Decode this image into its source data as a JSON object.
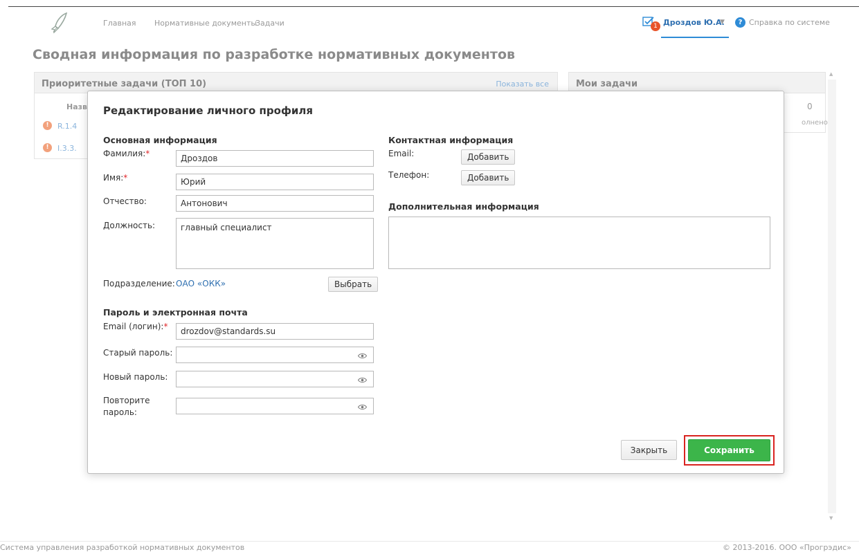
{
  "header": {
    "nav": [
      "Главная",
      "Нормативные документы",
      "Задачи"
    ],
    "notifications_count": "1",
    "user_name": "Дроздов Ю.А.",
    "help_label": "Справка по системе",
    "icons": [
      "rocket-logo-icon",
      "tasks-icon",
      "help-icon",
      "caret-down-icon"
    ]
  },
  "page": {
    "title": "Сводная информация по разработке нормативных документов"
  },
  "priority_panel": {
    "title": "Приоритетные задачи (ТОП 10)",
    "show_all": "Показать все",
    "column": "Назв",
    "rows": [
      "R.1.4",
      "I.3.3."
    ]
  },
  "my_tasks_panel": {
    "title": "Мои задачи",
    "count": "0",
    "status": "олнено"
  },
  "modal": {
    "title": "Редактирование личного профиля",
    "basic": {
      "section": "Основная информация",
      "last_name_label": "Фамилия:",
      "last_name": "Дроздов",
      "first_name_label": "Имя:",
      "first_name": "Юрий",
      "middle_name_label": "Отчество:",
      "middle_name": "Антонович",
      "position_label": "Должность:",
      "position": "главный специалист",
      "department_label": "Подразделение:",
      "department": "ОАО «ОКК»",
      "select_button": "Выбрать"
    },
    "password": {
      "section": "Пароль и электронная почта",
      "email_label": "Email (логин):",
      "email": "drozdov@standards.su",
      "old_password_label": "Старый пароль:",
      "new_password_label": "Новый пароль:",
      "repeat_password_label_1": "Повторите",
      "repeat_password_label_2": "пароль:"
    },
    "contact": {
      "section": "Контактная информация",
      "email_label": "Email:",
      "phone_label": "Телефон:",
      "add_button": "Добавить"
    },
    "additional": {
      "section": "Дополнительная информация",
      "text": ""
    },
    "close_button": "Закрыть",
    "save_button": "Сохранить"
  },
  "footer": {
    "left": "Система управления разработкой нормативных документов",
    "right": "© 2013-2016. ООО «Прогрэдис»"
  },
  "colors": {
    "accent": "#2e8bd6",
    "save": "#3cb54a",
    "highlight": "#d9231f",
    "badge": "#e8542a"
  }
}
